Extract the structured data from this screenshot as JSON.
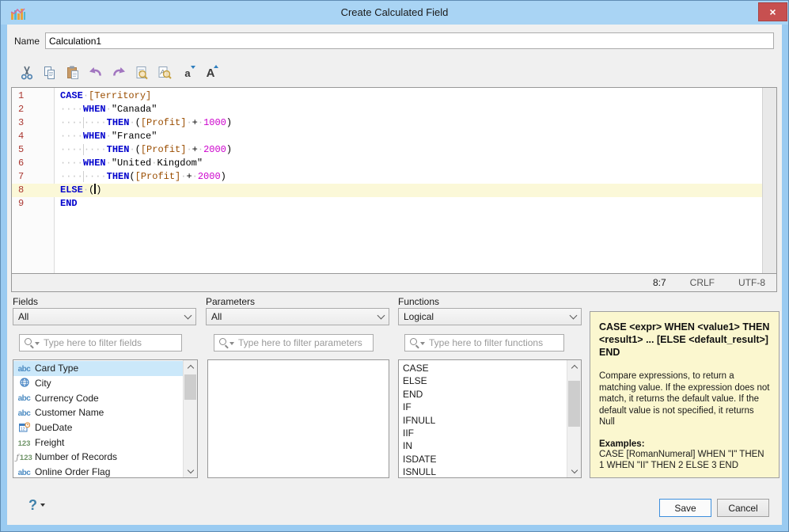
{
  "window": {
    "title": "Create Calculated Field"
  },
  "titlebar": {
    "close_icon": "×"
  },
  "name_row": {
    "label": "Name",
    "value": "Calculation1"
  },
  "toolbar": {
    "icons": [
      "cut-icon",
      "copy-icon",
      "paste-icon",
      "undo-icon",
      "redo-icon",
      "find-icon",
      "find-replace-icon",
      "font-decrease-icon",
      "font-increase-icon"
    ],
    "font_small_glyph": "a",
    "font_large_glyph": "A"
  },
  "editor": {
    "current_line": 8,
    "lines": [
      {
        "num": 1,
        "segments": [
          {
            "type": "kw",
            "text": "CASE"
          },
          {
            "type": "ws",
            "text": " "
          },
          {
            "type": "field",
            "text": "[Territory]"
          }
        ]
      },
      {
        "num": 2,
        "segments": [
          {
            "type": "ws",
            "text": "    "
          },
          {
            "type": "kw",
            "text": "WHEN"
          },
          {
            "type": "ws",
            "text": " "
          },
          {
            "type": "str",
            "text": "\"Canada\""
          }
        ]
      },
      {
        "num": 3,
        "segments": [
          {
            "type": "ws",
            "text": "    "
          },
          {
            "type": "wsg",
            "text": "    "
          },
          {
            "type": "kw",
            "text": "THEN"
          },
          {
            "type": "ws",
            "text": " "
          },
          {
            "type": "pun",
            "text": "("
          },
          {
            "type": "field",
            "text": "[Profit]"
          },
          {
            "type": "ws",
            "text": " "
          },
          {
            "type": "pun",
            "text": "+"
          },
          {
            "type": "ws",
            "text": " "
          },
          {
            "type": "num",
            "text": "1000"
          },
          {
            "type": "pun",
            "text": ")"
          }
        ]
      },
      {
        "num": 4,
        "segments": [
          {
            "type": "ws",
            "text": "    "
          },
          {
            "type": "kw",
            "text": "WHEN"
          },
          {
            "type": "ws",
            "text": " "
          },
          {
            "type": "str",
            "text": "\"France\""
          }
        ]
      },
      {
        "num": 5,
        "segments": [
          {
            "type": "ws",
            "text": "    "
          },
          {
            "type": "wsg",
            "text": "    "
          },
          {
            "type": "kw",
            "text": "THEN"
          },
          {
            "type": "ws",
            "text": " "
          },
          {
            "type": "pun",
            "text": "("
          },
          {
            "type": "field",
            "text": "[Profit]"
          },
          {
            "type": "ws",
            "text": " "
          },
          {
            "type": "pun",
            "text": "+"
          },
          {
            "type": "ws",
            "text": " "
          },
          {
            "type": "num",
            "text": "2000"
          },
          {
            "type": "pun",
            "text": ")"
          }
        ]
      },
      {
        "num": 6,
        "segments": [
          {
            "type": "ws",
            "text": "    "
          },
          {
            "type": "kw",
            "text": "WHEN"
          },
          {
            "type": "ws",
            "text": " "
          },
          {
            "type": "str",
            "text": "\"United"
          },
          {
            "type": "ws",
            "text": " "
          },
          {
            "type": "str",
            "text": "Kingdom\""
          }
        ]
      },
      {
        "num": 7,
        "segments": [
          {
            "type": "ws",
            "text": "    "
          },
          {
            "type": "wsg",
            "text": "    "
          },
          {
            "type": "kw",
            "text": "THEN"
          },
          {
            "type": "pun",
            "text": "("
          },
          {
            "type": "field",
            "text": "[Profit]"
          },
          {
            "type": "ws",
            "text": " "
          },
          {
            "type": "pun",
            "text": "+"
          },
          {
            "type": "ws",
            "text": " "
          },
          {
            "type": "num",
            "text": "2000"
          },
          {
            "type": "pun",
            "text": ")"
          }
        ]
      },
      {
        "num": 8,
        "segments": [
          {
            "type": "kw",
            "text": "ELSE"
          },
          {
            "type": "ws",
            "text": " "
          },
          {
            "type": "pun",
            "text": "("
          },
          {
            "type": "cursor"
          },
          {
            "type": "pun",
            "text": ")"
          }
        ]
      },
      {
        "num": 9,
        "segments": [
          {
            "type": "kw",
            "text": "END"
          }
        ]
      }
    ],
    "status": {
      "position": "8:7",
      "line_ending": "CRLF",
      "encoding": "UTF-8"
    }
  },
  "panels": {
    "fields": {
      "label": "Fields",
      "dropdown_value": "All",
      "filter_placeholder": "Type here to filter fields",
      "items": [
        {
          "icon": "abc",
          "label": "Card Type",
          "selected": true
        },
        {
          "icon": "globe",
          "label": "City"
        },
        {
          "icon": "abc",
          "label": "Currency Code"
        },
        {
          "icon": "abc",
          "label": "Customer Name"
        },
        {
          "icon": "date-clock",
          "label": "DueDate"
        },
        {
          "icon": "num",
          "label": "Freight"
        },
        {
          "icon": "calc-num",
          "label": "Number of Records"
        },
        {
          "icon": "abc",
          "label": "Online Order Flag"
        }
      ]
    },
    "parameters": {
      "label": "Parameters",
      "dropdown_value": "All",
      "filter_placeholder": "Type here to filter parameters",
      "items": []
    },
    "functions": {
      "label": "Functions",
      "dropdown_value": "Logical",
      "filter_placeholder": "Type here to filter functions",
      "items": [
        "CASE",
        "ELSE",
        "END",
        "IF",
        "IFNULL",
        "IIF",
        "IN",
        "ISDATE",
        "ISNULL"
      ]
    }
  },
  "help_box": {
    "syntax": "CASE <expr> WHEN <value1> THEN <result1> ... [ELSE <default_result>] END",
    "description": "Compare expressions, to return a matching value. If the expression does not match, it returns the default value. If the default value is not specified, it returns Null",
    "examples_label": "Examples:",
    "example": "CASE [RomanNumeral] WHEN \"I\" THEN 1 WHEN \"II\" THEN 2 ELSE 3 END"
  },
  "footer": {
    "help_icon": "?",
    "save_label": "Save",
    "cancel_label": "Cancel"
  },
  "icon_glyphs": {
    "abc": "abc",
    "num": "123",
    "calc": "ƒ"
  },
  "colors": {
    "keyword": "#0000cc",
    "field": "#9a4d00",
    "number": "#cc00cc",
    "string": "#000000",
    "current_line": "#fbf8d8",
    "selection": "#cbe8fa",
    "help_bg": "#fbf7cf",
    "titlebar": "#9acbf1",
    "close_button": "#c75050",
    "accent_blue": "#3d8fdd"
  }
}
